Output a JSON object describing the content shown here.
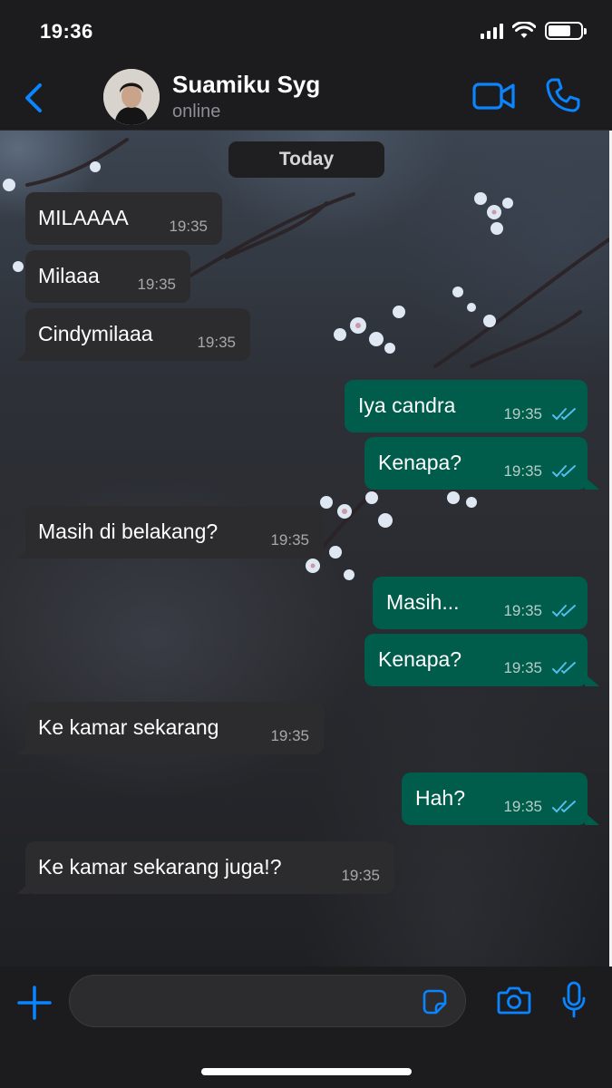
{
  "status_bar": {
    "time": "19:36",
    "battery_level": 0.72,
    "signal_bars": 4
  },
  "header": {
    "contact_name": "Suamiku Syg",
    "contact_status": "online",
    "icons": {
      "back": "chevron-left-icon",
      "video": "video-camera-icon",
      "call": "phone-icon"
    },
    "accent_color": "#0a84ff"
  },
  "chat": {
    "date_label": "Today",
    "messages": [
      {
        "direction": "in",
        "text": "MILAAAA",
        "time": "19:35"
      },
      {
        "direction": "in",
        "text": "Milaaa",
        "time": "19:35"
      },
      {
        "direction": "in",
        "text": "Cindymilaaa",
        "time": "19:35"
      },
      {
        "direction": "out",
        "text": "Iya candra",
        "time": "19:35",
        "read": true
      },
      {
        "direction": "out",
        "text": "Kenapa?",
        "time": "19:35",
        "read": true
      },
      {
        "direction": "in",
        "text": "Masih di belakang?",
        "time": "19:35"
      },
      {
        "direction": "out",
        "text": "Masih...",
        "time": "19:35",
        "read": true
      },
      {
        "direction": "out",
        "text": "Kenapa?",
        "time": "19:35",
        "read": true
      },
      {
        "direction": "in",
        "text": "Ke kamar sekarang",
        "time": "19:35"
      },
      {
        "direction": "out",
        "text": "Hah?",
        "time": "19:35",
        "read": true
      },
      {
        "direction": "in",
        "text": "Ke kamar sekarang juga!?",
        "time": "19:35"
      }
    ],
    "colors": {
      "incoming_bubble": "#2c2c2e",
      "outgoing_bubble": "#005c4b",
      "read_ticks": "#53bdeb"
    }
  },
  "composer": {
    "message_value": "",
    "message_placeholder": "",
    "icons": {
      "add": "plus-icon",
      "sticker": "sticker-icon",
      "camera": "camera-icon",
      "mic": "microphone-icon"
    }
  }
}
